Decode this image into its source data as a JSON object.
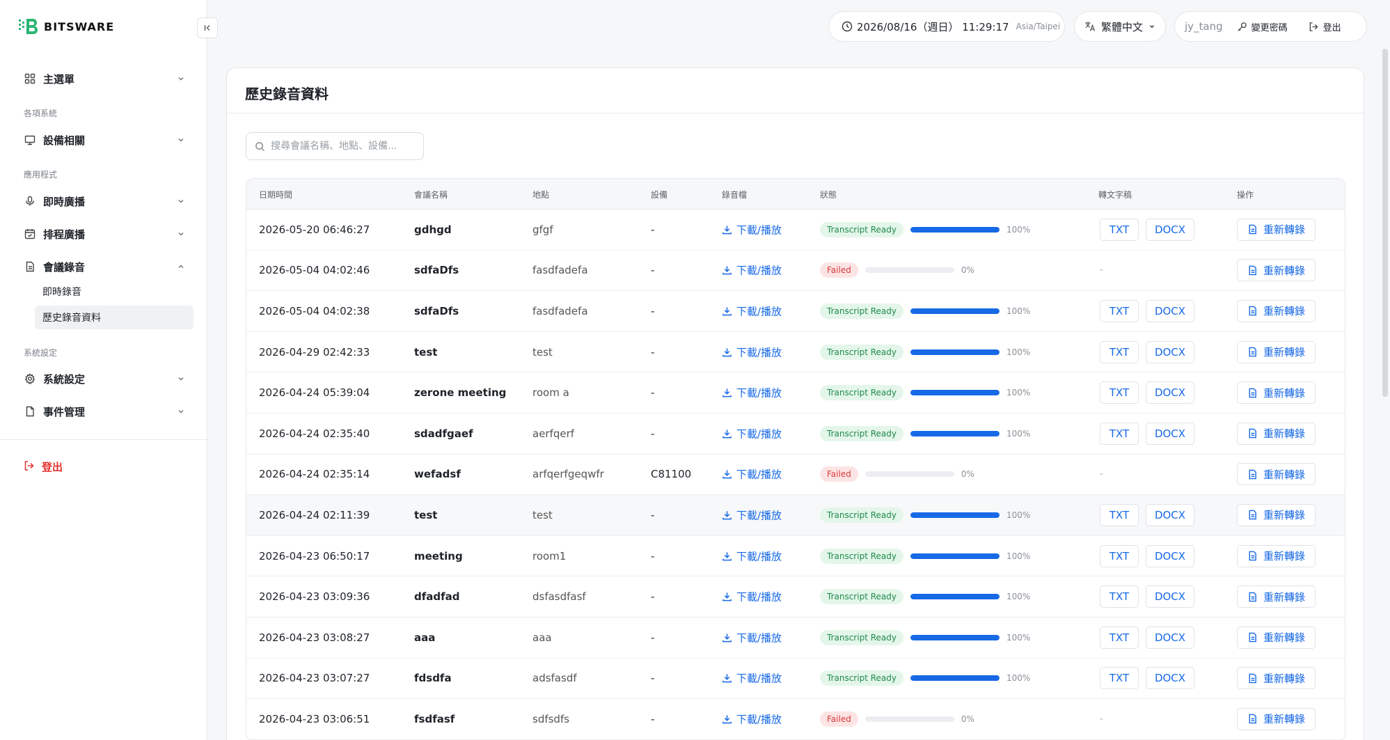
{
  "brand": {
    "name": "BITSWARE"
  },
  "sidebar": {
    "main_menu": "主選單",
    "section_systems": "各項系統",
    "devices": "設備相關",
    "section_apps": "應用程式",
    "live_broadcast": "即時廣播",
    "scheduled_broadcast": "排程廣播",
    "meeting_recording": "會議錄音",
    "sub_live_recording": "即時錄音",
    "sub_history": "歷史錄音資料",
    "section_settings": "系統設定",
    "system_settings": "系統設定",
    "event_management": "事件管理",
    "logout": "登出"
  },
  "topbar": {
    "datetime": "2026/08/16（週日） 11:29:17",
    "timezone": "Asia/Taipei",
    "language": "繁體中文",
    "username": "jy_tang",
    "change_password": "變更密碼",
    "logout": "登出"
  },
  "page": {
    "title": "歷史錄音資料",
    "search_placeholder": "搜尋會議名稱、地點、設備..."
  },
  "table": {
    "headers": [
      "日期時間",
      "會議名稱",
      "地點",
      "設備",
      "錄音檔",
      "狀態",
      "轉文字稿",
      "操作"
    ],
    "download_label": "下載/播放",
    "txt_label": "TXT",
    "docx_label": "DOCX",
    "redo_label": "重新轉錄",
    "rows": [
      {
        "datetime": "2026-05-20 06:46:27",
        "name": "gdhgd",
        "location": "gfgf",
        "device": "-",
        "status": "Transcript Ready",
        "ok": true,
        "progress": 100,
        "pct": "100%"
      },
      {
        "datetime": "2026-05-04 04:02:46",
        "name": "sdfaDfs",
        "location": "fasdfadefa",
        "device": "-",
        "status": "Failed",
        "ok": false,
        "progress": 0,
        "pct": "0%"
      },
      {
        "datetime": "2026-05-04 04:02:38",
        "name": "sdfaDfs",
        "location": "fasdfadefa",
        "device": "-",
        "status": "Transcript Ready",
        "ok": true,
        "progress": 100,
        "pct": "100%"
      },
      {
        "datetime": "2026-04-29 02:42:33",
        "name": "test",
        "location": "test",
        "device": "-",
        "status": "Transcript Ready",
        "ok": true,
        "progress": 100,
        "pct": "100%"
      },
      {
        "datetime": "2026-04-24 05:39:04",
        "name": "zerone meeting",
        "location": "room a",
        "device": "-",
        "status": "Transcript Ready",
        "ok": true,
        "progress": 100,
        "pct": "100%"
      },
      {
        "datetime": "2026-04-24 02:35:40",
        "name": "sdadfgaef",
        "location": "aerfqerf",
        "device": "-",
        "status": "Transcript Ready",
        "ok": true,
        "progress": 100,
        "pct": "100%"
      },
      {
        "datetime": "2026-04-24 02:35:14",
        "name": "wefadsf",
        "location": "arfqerfgeqwfr",
        "device": "C81100",
        "status": "Failed",
        "ok": false,
        "progress": 0,
        "pct": "0%"
      },
      {
        "datetime": "2026-04-24 02:11:39",
        "name": "test",
        "location": "test",
        "device": "-",
        "status": "Transcript Ready",
        "ok": true,
        "progress": 100,
        "pct": "100%"
      },
      {
        "datetime": "2026-04-23 06:50:17",
        "name": "meeting",
        "location": "room1",
        "device": "-",
        "status": "Transcript Ready",
        "ok": true,
        "progress": 100,
        "pct": "100%"
      },
      {
        "datetime": "2026-04-23 03:09:36",
        "name": "dfadfad",
        "location": "dsfasdfasf",
        "device": "-",
        "status": "Transcript Ready",
        "ok": true,
        "progress": 100,
        "pct": "100%"
      },
      {
        "datetime": "2026-04-23 03:08:27",
        "name": "aaa",
        "location": "aaa",
        "device": "-",
        "status": "Transcript Ready",
        "ok": true,
        "progress": 100,
        "pct": "100%"
      },
      {
        "datetime": "2026-04-23 03:07:27",
        "name": "fdsdfa",
        "location": "adsfasdf",
        "device": "-",
        "status": "Transcript Ready",
        "ok": true,
        "progress": 100,
        "pct": "100%"
      },
      {
        "datetime": "2026-04-23 03:06:51",
        "name": "fsdfasf",
        "location": "sdfsdfs",
        "device": "-",
        "status": "Failed",
        "ok": false,
        "progress": 0,
        "pct": "0%"
      }
    ],
    "no_transcript": "-"
  }
}
